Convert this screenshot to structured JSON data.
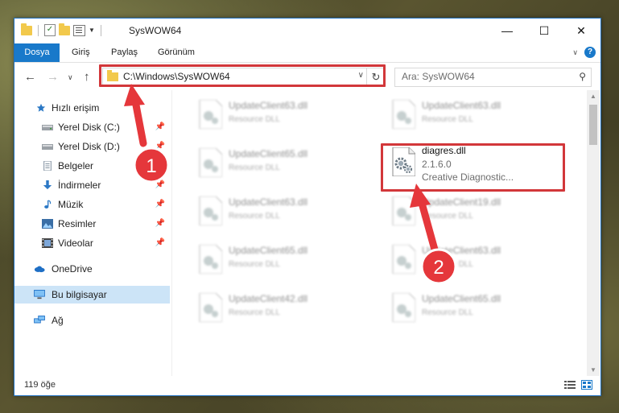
{
  "window": {
    "title": "SysWOW64",
    "ribbon_tabs": [
      "Dosya",
      "Giriş",
      "Paylaş",
      "Görünüm"
    ]
  },
  "navigation": {
    "address": "C:\\Windows\\SysWOW64",
    "search_placeholder": "Ara: SysWOW64"
  },
  "sidebar": {
    "quick_access": "Hızlı erişim",
    "pinned": [
      "Yerel Disk (C:)",
      "Yerel Disk (D:)",
      "Belgeler",
      "İndirmeler",
      "Müzik",
      "Resimler",
      "Videolar"
    ],
    "onedrive": "OneDrive",
    "this_pc": "Bu bilgisayar",
    "network": "Ağ"
  },
  "files": {
    "left_column": [
      {
        "name": "UpdateClient63.dll",
        "type": "Resource DLL"
      },
      {
        "name": "UpdateClient65.dll",
        "type": "Resource DLL"
      },
      {
        "name": "UpdateClient63.dll",
        "type": "Resource DLL"
      },
      {
        "name": "UpdateClient65.dll",
        "type": "Resource DLL"
      },
      {
        "name": "UpdateClient42.dll",
        "type": "Resource DLL"
      }
    ],
    "right_column": [
      {
        "name": "UpdateClient63.dll",
        "type": "Resource DLL"
      },
      {
        "name": "UpdateClient19.dll",
        "type": "Resource DLL"
      },
      {
        "name": "UpdateClient63.dll",
        "type": "Resource DLL"
      },
      {
        "name": "UpdateClient65.dll",
        "type": "Resource DLL"
      }
    ],
    "highlighted": {
      "name": "diagres.dll",
      "version": "2.1.6.0",
      "description": "Creative Diagnostic..."
    }
  },
  "status": {
    "item_count": "119 öğe"
  },
  "annotations": {
    "step1": "1",
    "step2": "2"
  },
  "colors": {
    "accent": "#1979ca",
    "highlight_red": "#d2373a",
    "selected_nav": "#cce4f7"
  }
}
